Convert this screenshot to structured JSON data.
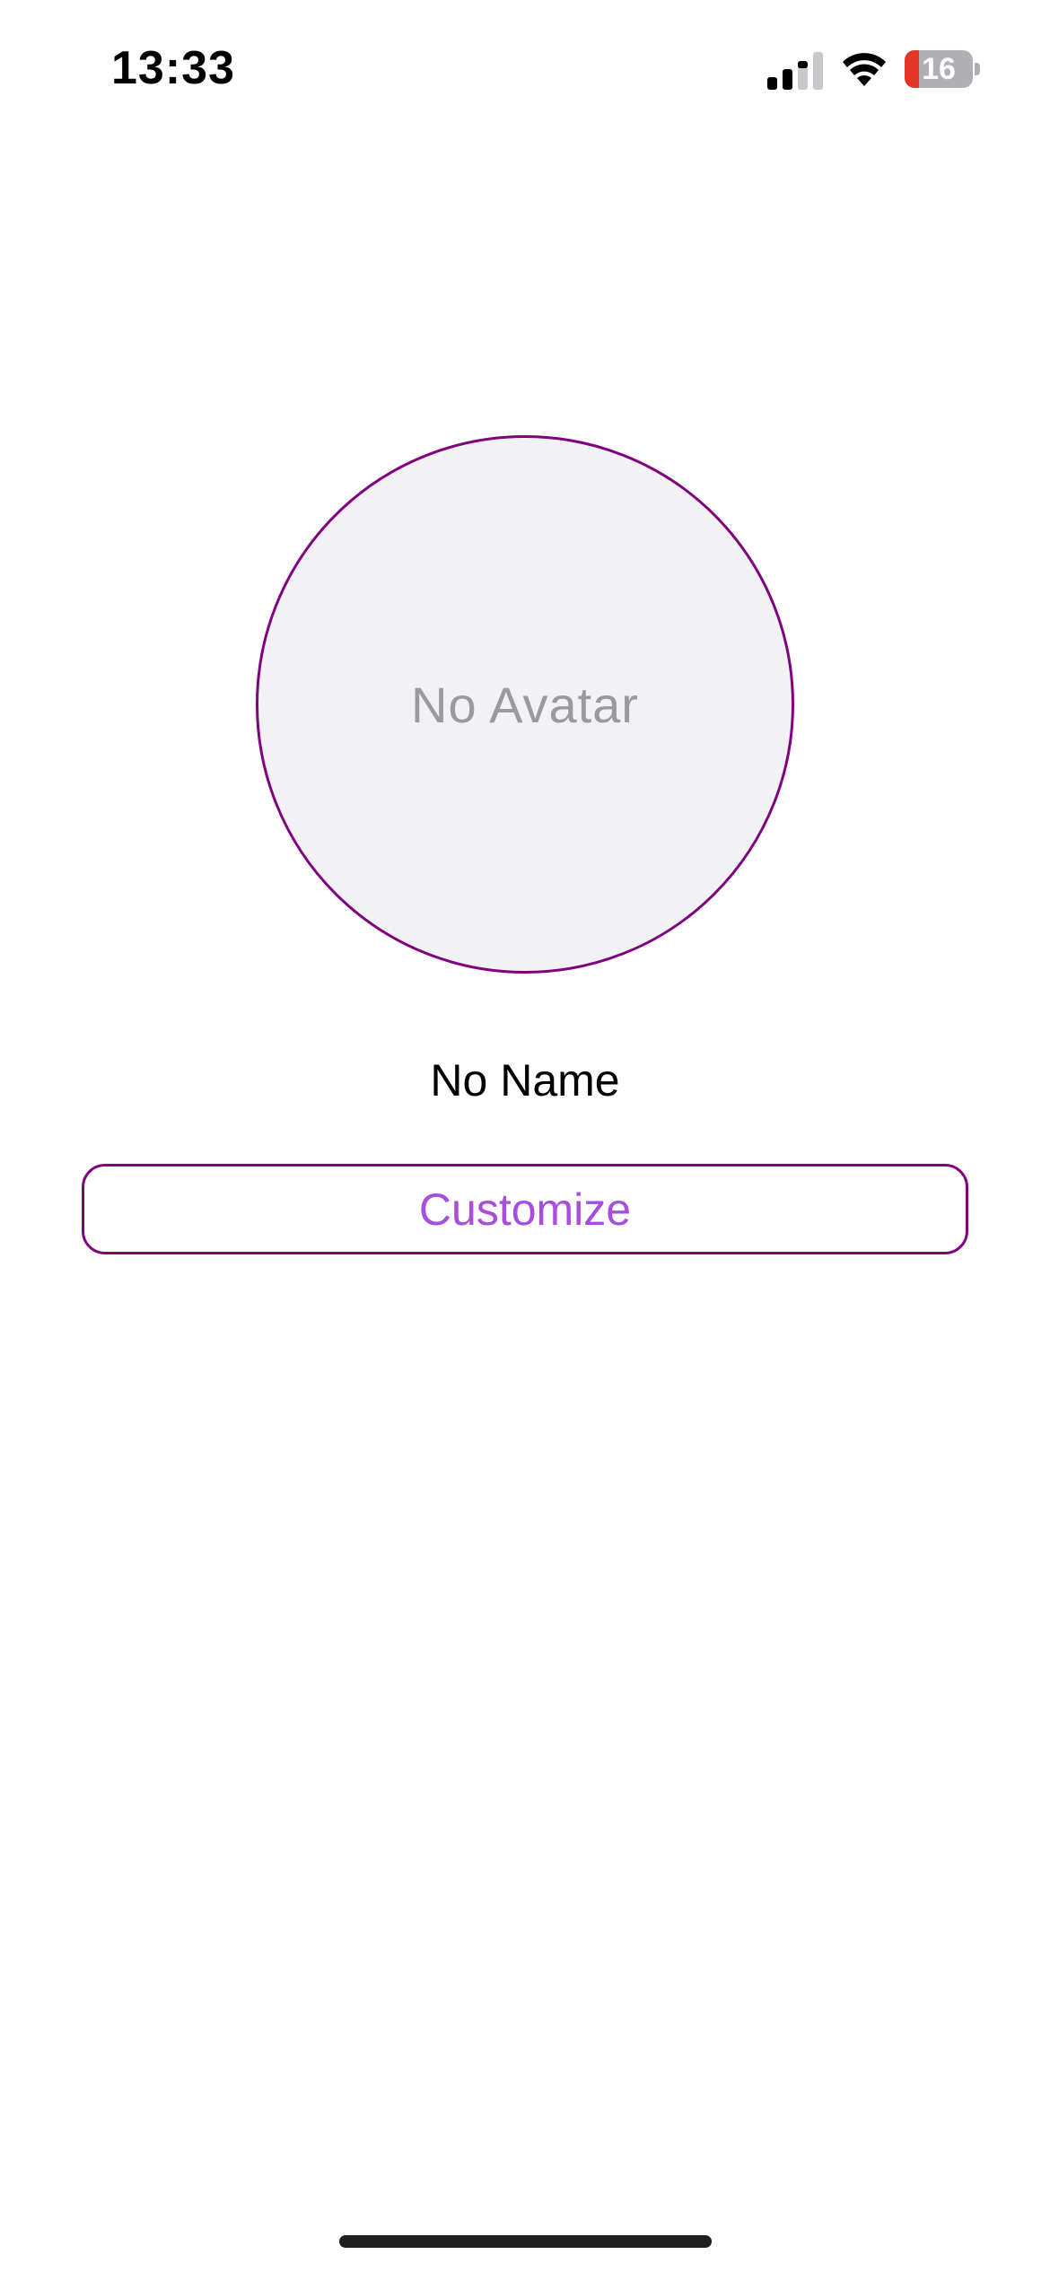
{
  "status_bar": {
    "time": "13:33",
    "battery_level": 16,
    "battery_text": "16",
    "battery_color": "#e5352b",
    "icons": [
      "signal-icon",
      "wifi-icon",
      "battery-icon"
    ]
  },
  "profile": {
    "avatar_placeholder": "No Avatar",
    "name": "No Name",
    "customize_label": "Customize"
  },
  "colors": {
    "accent_border": "#800080",
    "button_text": "#a94ddc",
    "avatar_bg": "#f2f2f4"
  }
}
